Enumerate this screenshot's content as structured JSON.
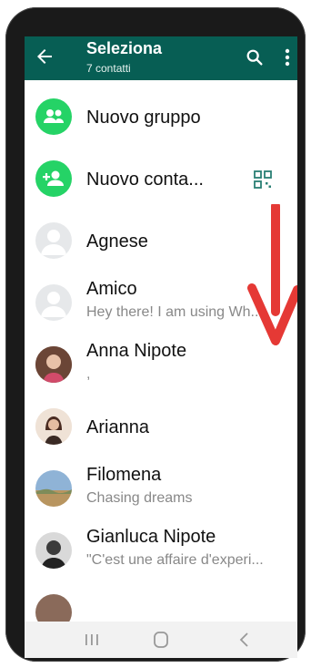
{
  "header": {
    "title": "Seleziona",
    "subtitle": "7 contatti",
    "icons": [
      "arrow-back-icon",
      "search-icon",
      "more-vert-icon"
    ]
  },
  "actions": [
    {
      "label": "Nuovo gruppo",
      "icon": "group-add-icon"
    },
    {
      "label": "Nuovo conta...",
      "icon": "person-add-icon",
      "trailing_icon": "qr-code-icon"
    }
  ],
  "contacts": [
    {
      "name": "Agnese",
      "status": ""
    },
    {
      "name": "Amico",
      "status": "Hey there! I am using Wh..."
    },
    {
      "name": "Anna Nipote",
      "status": ","
    },
    {
      "name": "Arianna",
      "status": ""
    },
    {
      "name": "Filomena",
      "status": "Chasing dreams"
    },
    {
      "name": "Gianluca Nipote",
      "status": "\"C'est une affaire d'experi..."
    }
  ],
  "colors": {
    "appbar": "#075e54",
    "accent_green": "#25d366",
    "annotation_arrow": "#e53935"
  },
  "navbar": [
    "recents-icon",
    "home-icon",
    "back-icon"
  ]
}
